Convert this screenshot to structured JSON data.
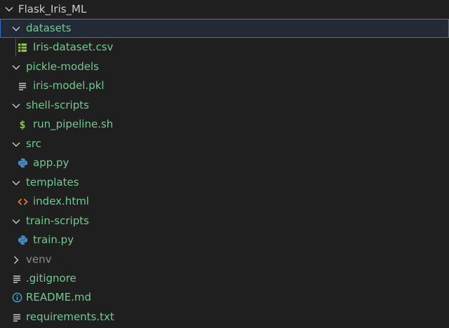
{
  "explorer": {
    "root": {
      "label": "Flask_Iris_ML",
      "expanded": true
    },
    "items": [
      {
        "label": "datasets",
        "type": "folder",
        "expanded": true,
        "color": "#73c991",
        "icon": "chevron-down-icon"
      },
      {
        "label": "Iris-dataset.csv",
        "type": "file",
        "color": "#73c991",
        "icon": "table-csv-icon"
      },
      {
        "label": "pickle-models",
        "type": "folder",
        "expanded": true,
        "color": "#73c991",
        "icon": "chevron-down-icon"
      },
      {
        "label": "iris-model.pkl",
        "type": "file",
        "color": "#73c991",
        "icon": "lines-file-icon"
      },
      {
        "label": "shell-scripts",
        "type": "folder",
        "expanded": true,
        "color": "#73c991",
        "icon": "chevron-down-icon"
      },
      {
        "label": "run_pipeline.sh",
        "type": "file",
        "color": "#73c991",
        "icon": "dollar-icon"
      },
      {
        "label": "src",
        "type": "folder",
        "expanded": true,
        "color": "#73c991",
        "icon": "chevron-down-icon"
      },
      {
        "label": "app.py",
        "type": "file",
        "color": "#73c991",
        "icon": "python-icon"
      },
      {
        "label": "templates",
        "type": "folder",
        "expanded": true,
        "color": "#73c991",
        "icon": "chevron-down-icon"
      },
      {
        "label": "index.html",
        "type": "file",
        "color": "#73c991",
        "icon": "html-code-icon"
      },
      {
        "label": "train-scripts",
        "type": "folder",
        "expanded": true,
        "color": "#73c991",
        "icon": "chevron-down-icon"
      },
      {
        "label": "train.py",
        "type": "file",
        "color": "#73c991",
        "icon": "python-icon"
      },
      {
        "label": "venv",
        "type": "folder",
        "expanded": false,
        "color": "#8c8c8c",
        "icon": "chevron-right-icon"
      },
      {
        "label": ".gitignore",
        "type": "file",
        "color": "#73c991",
        "icon": "lines-file-icon"
      },
      {
        "label": "README.md",
        "type": "file",
        "color": "#73c991",
        "icon": "info-icon"
      },
      {
        "label": "requirements.txt",
        "type": "file",
        "color": "#73c991",
        "icon": "lines-file-icon"
      }
    ]
  },
  "colors": {
    "background": "#1f1f1f",
    "selection_border": "#2f6fd1",
    "added_file": "#73c991",
    "ignored": "#8c8c8c",
    "python_icon": "#4b8bbe",
    "html_icon": "#e37933",
    "info_icon": "#519aba",
    "csv_icon": "#8bc34a"
  }
}
